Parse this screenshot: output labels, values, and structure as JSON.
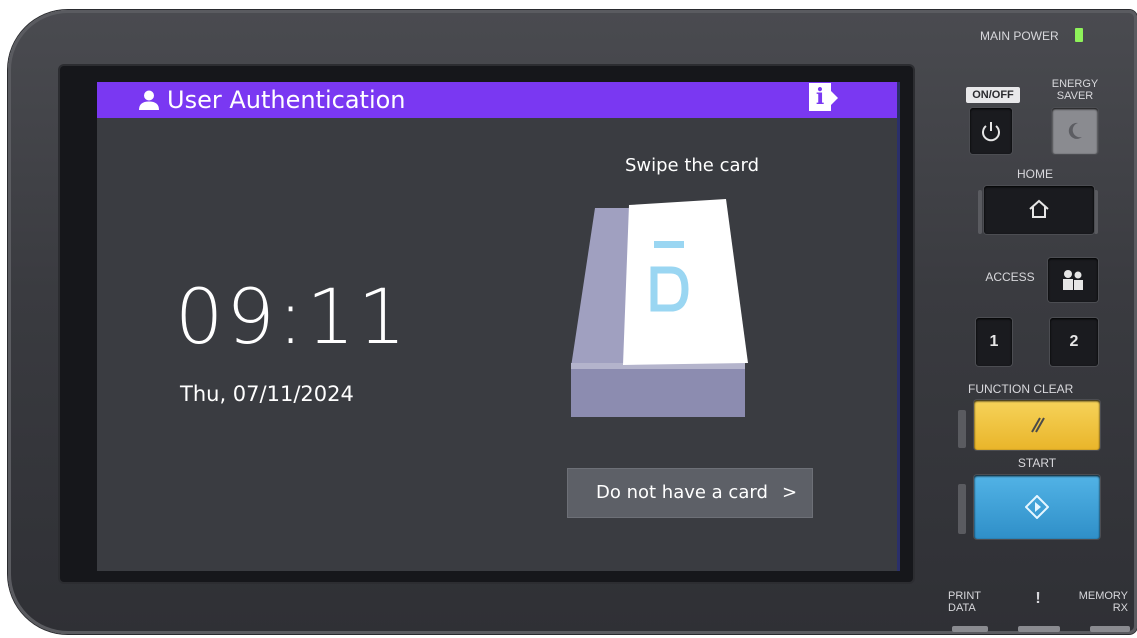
{
  "screen": {
    "title": "User Authentication",
    "info_glyph": "i",
    "clock": "09:11",
    "date": "Thu, 07/11/2024",
    "swipe_prompt": "Swipe the card",
    "card_text": "ID",
    "no_card_button": "Do not have a card",
    "no_card_chevron": ">",
    "accent": "#7a38f2",
    "background": "#3a3c41"
  },
  "panel": {
    "main_power": "MAIN POWER",
    "on_off": "ON/OFF",
    "energy_saver": "ENERGY SAVER",
    "home": "HOME",
    "access": "ACCESS",
    "button_1": "1",
    "button_2": "2",
    "function_clear": "FUNCTION CLEAR",
    "start": "START",
    "print_data": "PRINT DATA",
    "error": "!",
    "memory_rx": "MEMORY RX",
    "icons": [
      "power-icon",
      "moon-icon",
      "home-icon",
      "access-icon",
      "clear-icon",
      "start-icon"
    ],
    "colors": {
      "function_clear": "#f2c23c",
      "start": "#3ea1d8",
      "main_power_led": "#8ef25a"
    }
  }
}
